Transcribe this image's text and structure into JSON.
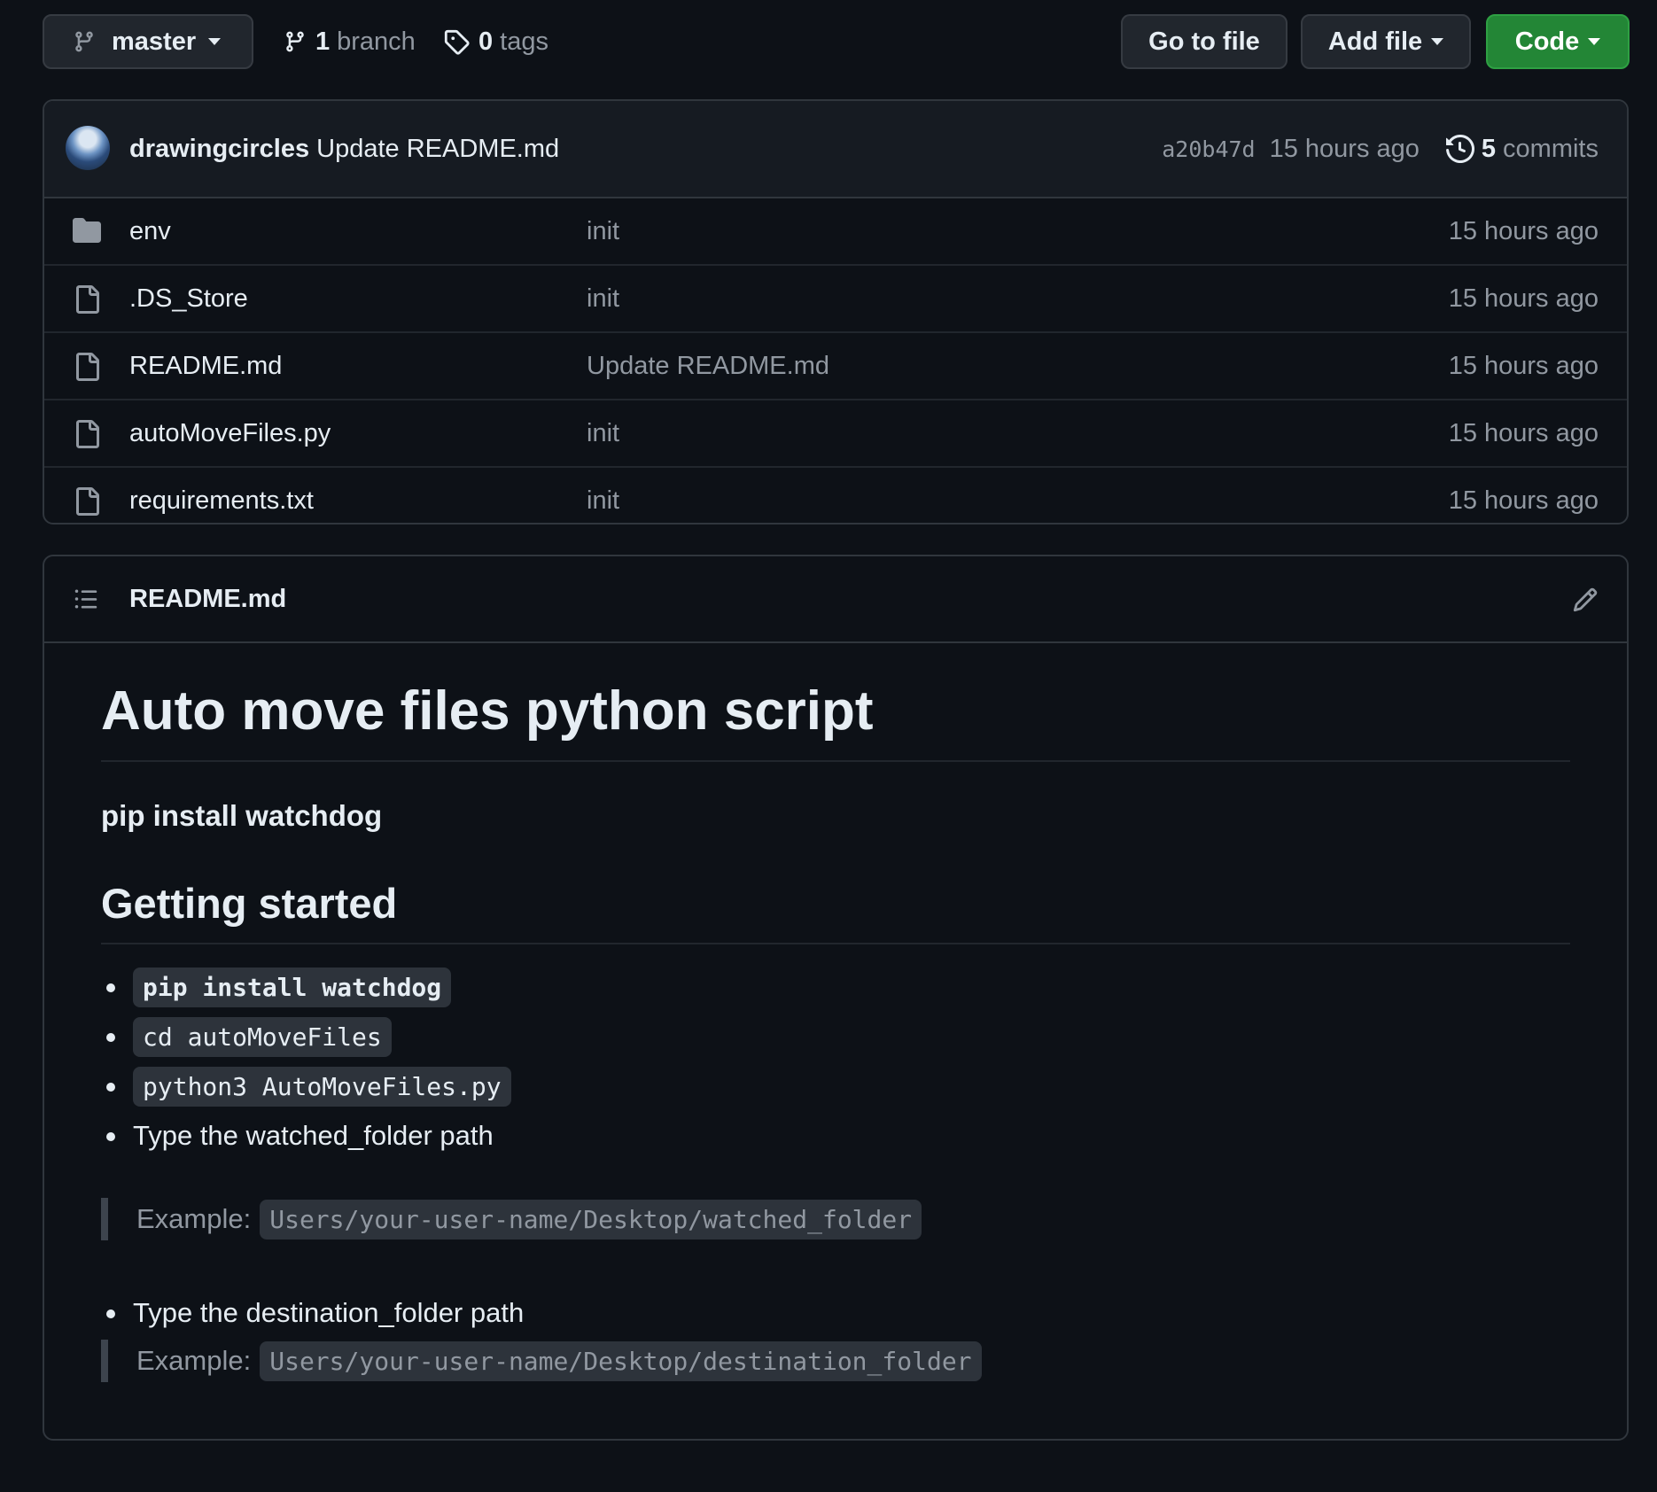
{
  "toolbar": {
    "branch_name": "master",
    "branch_count": "1",
    "branch_word": "branch",
    "tag_count": "0",
    "tag_word": "tags",
    "go_to_file": "Go to file",
    "add_file": "Add file",
    "code": "Code"
  },
  "latest_commit": {
    "author": "drawingcircles",
    "message": "Update README.md",
    "sha": "a20b47d",
    "time": "15 hours ago",
    "commit_count": "5",
    "commit_word": "commits"
  },
  "files": [
    {
      "icon": "folder-icon",
      "name": "env",
      "message": "init",
      "time": "15 hours ago"
    },
    {
      "icon": "file-icon",
      "name": ".DS_Store",
      "message": "init",
      "time": "15 hours ago"
    },
    {
      "icon": "file-icon",
      "name": "README.md",
      "message": "Update README.md",
      "time": "15 hours ago"
    },
    {
      "icon": "file-icon",
      "name": "autoMoveFiles.py",
      "message": "init",
      "time": "15 hours ago"
    },
    {
      "icon": "file-icon",
      "name": "requirements.txt",
      "message": "init",
      "time": "15 hours ago"
    }
  ],
  "readme": {
    "filename": "README.md",
    "h1": "Auto move files python script",
    "bold_line": "pip install watchdog",
    "h2": "Getting started",
    "steps": [
      "pip install watchdog",
      "cd autoMoveFiles",
      "python3 AutoMoveFiles.py"
    ],
    "step_watched": "Type the watched_folder path",
    "example_label": "Example:",
    "example_watched": "Users/your-user-name/Desktop/watched_folder",
    "step_destination": "Type the destination_folder path",
    "example_destination": "Users/your-user-name/Desktop/destination_folder"
  },
  "colors": {
    "background": "#0d1117",
    "code_button": "#238636",
    "border": "#30363d",
    "muted_text": "#9198a1"
  }
}
